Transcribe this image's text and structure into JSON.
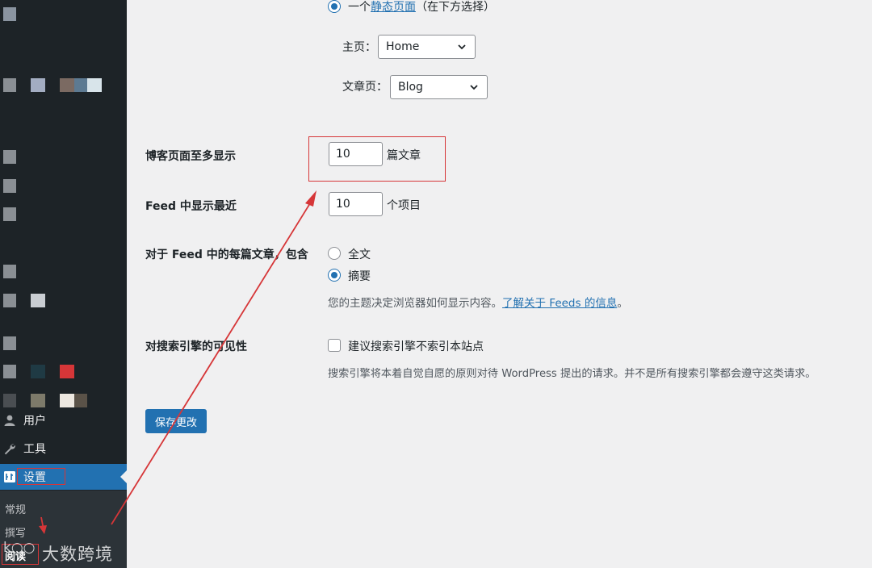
{
  "sidebar": {
    "items": [
      {
        "label": "用户",
        "icon": "user-icon"
      },
      {
        "label": "工具",
        "icon": "wrench-icon"
      },
      {
        "label": "设置",
        "icon": "settings-icon"
      }
    ],
    "submenu": [
      "常规",
      "撰写",
      "阅读"
    ],
    "watermark": "大数跨境"
  },
  "static_page": {
    "radio_label": "一个",
    "link_label": "静态页面",
    "suffix": "（在下方选择）",
    "homepage_label": "主页：",
    "homepage_value": "Home",
    "posts_page_label": "文章页：",
    "posts_page_value": "Blog"
  },
  "blog_pages": {
    "label": "博客页面至多显示",
    "value": "10",
    "unit": "篇文章"
  },
  "feed_recent": {
    "label": "Feed 中显示最近",
    "value": "10",
    "unit": "个项目"
  },
  "feed_content": {
    "label": "对于 Feed 中的每篇文章，包含",
    "option_full": "全文",
    "option_summary": "摘要",
    "selected": "摘要",
    "desc_prefix": "您的主题决定浏览器如何显示内容。",
    "desc_link": "了解关于 Feeds 的信息",
    "desc_suffix": "。"
  },
  "search_visibility": {
    "label": "对搜索引擎的可见性",
    "checkbox_label": "建议搜索引擎不索引本站点",
    "desc": "搜索引擎将本着自觉自愿的原则对待 WordPress 提出的请求。并不是所有搜索引擎都会遵守这类请求。"
  },
  "save_button": "保存更改",
  "colors": {
    "sidebar_bg": "#1d2327",
    "accent": "#2271b1",
    "annotation_red": "#d63638",
    "page_bg": "#f0f0f1"
  }
}
